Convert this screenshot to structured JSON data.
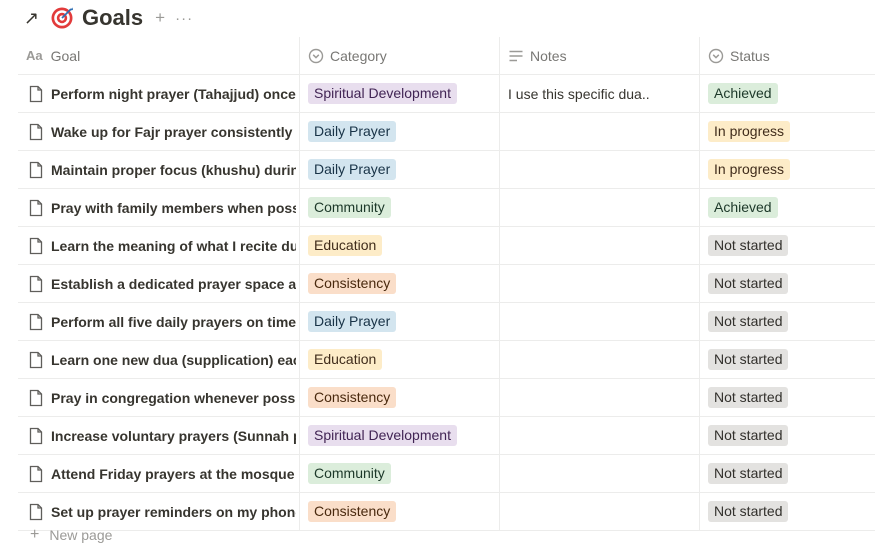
{
  "page": {
    "title": "Goals",
    "arrow_icon": "arrow-up-right-icon",
    "target_icon": "target-icon"
  },
  "columns": {
    "goal": "Goal",
    "category": "Category",
    "notes": "Notes",
    "status": "Status"
  },
  "rows": [
    {
      "goal": "Perform night prayer (Tahajjud) once a",
      "category": "Spiritual Development",
      "notes": "I use this specific dua..",
      "status": "Achieved"
    },
    {
      "goal": "Wake up for Fajr prayer consistently",
      "category": "Daily Prayer",
      "notes": "",
      "status": "In progress"
    },
    {
      "goal": "Maintain proper focus (khushu) during",
      "category": "Daily Prayer",
      "notes": "",
      "status": "In progress"
    },
    {
      "goal": "Pray with family members when possib",
      "category": "Community",
      "notes": "",
      "status": "Achieved"
    },
    {
      "goal": "Learn the meaning of what I recite duri",
      "category": "Education",
      "notes": "",
      "status": "Not started"
    },
    {
      "goal": "Establish a dedicated prayer space at h",
      "category": "Consistency",
      "notes": "",
      "status": "Not started"
    },
    {
      "goal": "Perform all five daily prayers on time",
      "category": "Daily Prayer",
      "notes": "",
      "status": "Not started"
    },
    {
      "goal": "Learn one new dua (supplication) each",
      "category": "Education",
      "notes": "",
      "status": "Not started"
    },
    {
      "goal": "Pray in congregation whenever possibl",
      "category": "Consistency",
      "notes": "",
      "status": "Not started"
    },
    {
      "goal": "Increase voluntary prayers (Sunnah pra",
      "category": "Spiritual Development",
      "notes": "",
      "status": "Not started"
    },
    {
      "goal": "Attend Friday prayers at the mosque re",
      "category": "Community",
      "notes": "",
      "status": "Not started"
    },
    {
      "goal": "Set up prayer reminders on my phone",
      "category": "Consistency",
      "notes": "",
      "status": "Not started"
    }
  ],
  "tag_colors": {
    "Spiritual Development": {
      "bg": "#e8deee",
      "fg": "#412454"
    },
    "Daily Prayer": {
      "bg": "#d3e5ef",
      "fg": "#183347"
    },
    "Community": {
      "bg": "#dbeddb",
      "fg": "#1c3829"
    },
    "Education": {
      "bg": "#fdecc8",
      "fg": "#402c1b"
    },
    "Consistency": {
      "bg": "#fadec9",
      "fg": "#49290e"
    },
    "Achieved": {
      "bg": "#dbeddb",
      "fg": "#1c3829"
    },
    "In progress": {
      "bg": "#fdecc8",
      "fg": "#402c1b"
    },
    "Not started": {
      "bg": "#e3e2e0",
      "fg": "#32302c"
    }
  },
  "footer": {
    "new_page": "New page"
  }
}
